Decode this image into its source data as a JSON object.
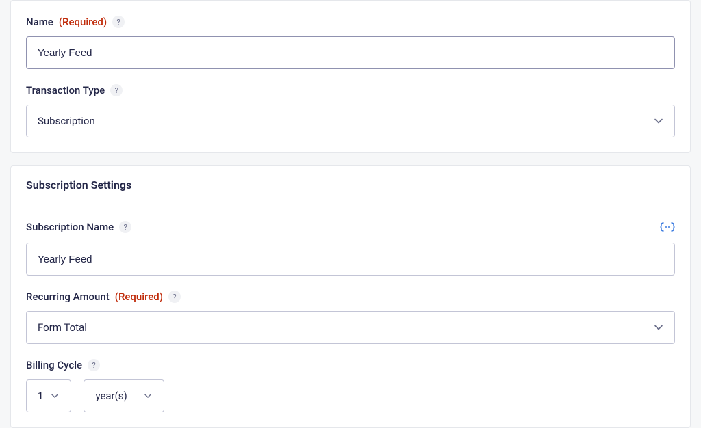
{
  "card1": {
    "name_label": "Name",
    "required_label": "(Required)",
    "name_value": "Yearly Feed",
    "transaction_type_label": "Transaction Type",
    "transaction_type_value": "Subscription"
  },
  "card2": {
    "heading": "Subscription Settings",
    "sub_name_label": "Subscription Name",
    "sub_name_value": "Yearly Feed",
    "recurring_label": "Recurring Amount",
    "required_label": "(Required)",
    "recurring_value": "Form Total",
    "billing_cycle_label": "Billing Cycle",
    "billing_number": "1",
    "billing_unit": "year(s)"
  },
  "help_glyph": "?"
}
